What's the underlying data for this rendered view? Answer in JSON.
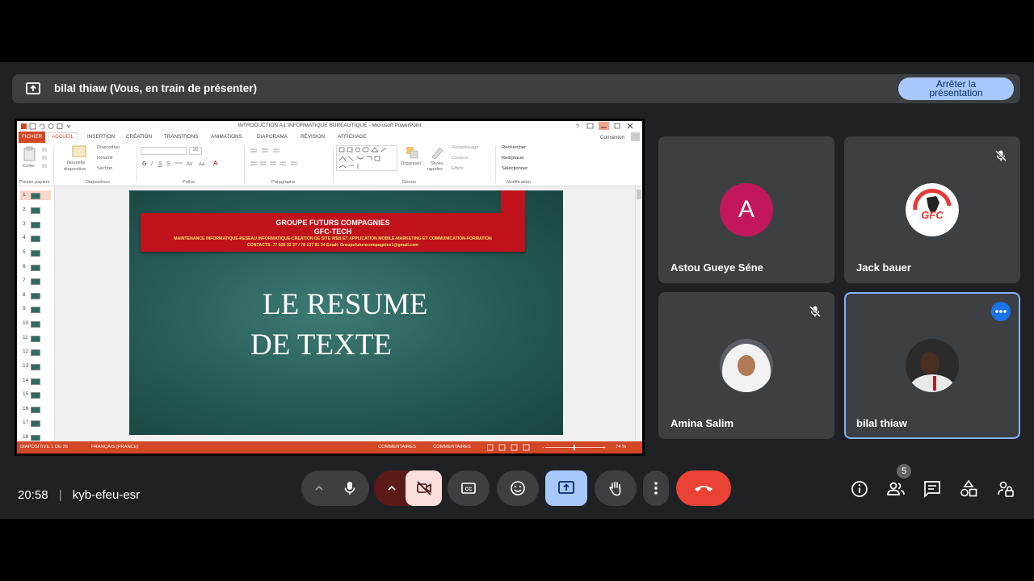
{
  "banner": {
    "text": "bilal thiaw (Vous, en train de présenter)",
    "stop_label": "Arrêter la présentation",
    "stop_color": "#a8c7fa"
  },
  "powerpoint": {
    "window_title": "INTRODUCTION A L'INFORMATIQUE BUREAUTIQUE - Microsoft PowerPoint",
    "help": "?",
    "connexion": "Connexion",
    "tabs": [
      "FICHIER",
      "ACCUEIL",
      "INSERTION",
      "CRÉATION",
      "TRANSITIONS",
      "ANIMATIONS",
      "DIAPORAMA",
      "RÉVISION",
      "AFFICHAGE"
    ],
    "ribbon": {
      "coller": "Coller",
      "nouvelle": "Nouvelle",
      "diapositive": "diapositive",
      "disposition": "Disposition",
      "retablir": "Rétablir",
      "section": "Section",
      "font_size": "20",
      "organiser": "Organiser",
      "styles": "Styles",
      "rapides": "rapides",
      "remplissage": "Remplissage",
      "contour": "Contour",
      "effets": "Effets",
      "rechercher": "Rechercher",
      "remplacer": "Remplacer",
      "selectionner": "Sélectionner",
      "groups": [
        "Presse-papiers",
        "Diapositives",
        "Police",
        "Paragraphe",
        "Dessin",
        "Modification"
      ]
    },
    "thumbnails": [
      "1",
      "2",
      "3",
      "4",
      "5",
      "6",
      "7",
      "8",
      "9",
      "10",
      "11",
      "12",
      "13",
      "14",
      "15",
      "16",
      "17",
      "18"
    ],
    "slide": {
      "header1": "GROUPE FUTURS COMPAGNIES",
      "header2": "GFC-TECH",
      "header3": "MAINTENANCE INFORMATIQUE-RESEAU INFORMATIQUE-CREATION DE SITE WEB ET APPLICATION MOBILE-MARKETING ET COMMUNICATION-FORMATION",
      "header4": "CONTACTS: 77 620 32 37 / 78 137 81 34  Email: Groupefuturscompagnies1@gmail.com",
      "title_line1": "LE RESUME",
      "title_line2": "DE TEXTE"
    },
    "status": {
      "slide_count": "DIAPOSITIVE 1 DE 26",
      "language": "FRANÇAIS (FRANCE)",
      "notes": "COMMENTAIRES",
      "comments": "COMMENTAIRES",
      "zoom": "74 %"
    },
    "accent": "#d24726"
  },
  "participants": [
    {
      "name": "Astou Gueye Séne",
      "initial": "A",
      "avatar_color": "#c2185b",
      "muted": false
    },
    {
      "name": "Jack bauer",
      "logo_text": "GFC",
      "muted": true
    },
    {
      "name": "Amina Salim",
      "muted": true
    },
    {
      "name": "bilal thiaw",
      "muted": false,
      "active": true
    }
  ],
  "footer": {
    "time": "20:58",
    "separator": "|",
    "meeting_code": "kyb-efeu-esr",
    "people_count": "5",
    "end_call_color": "#ea4335"
  }
}
